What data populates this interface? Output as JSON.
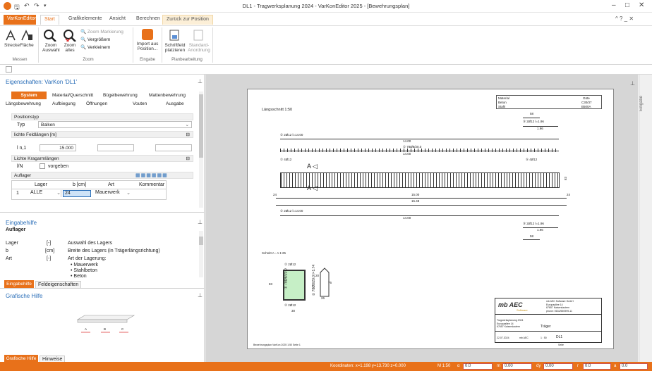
{
  "window": {
    "title": "DL1 - Tragwerksplanung 2024 - VarKonEditor 2025 - [Bewehrungsplan]",
    "controls": {
      "minimize": "–",
      "maximize": "□",
      "close": "✕"
    },
    "help": "^ ? _ ✕"
  },
  "tabs": [
    "VarKonEditor",
    "Start",
    "Grafikelemente",
    "Ansicht",
    "Berechnen",
    "Zurück zur Position"
  ],
  "ribbon": {
    "buttons": {
      "strecke": "Strecke",
      "flaeche": "Fläche",
      "zoom_auswahl": "Zoom\nAuswahl",
      "zoom_alles": "Zoom\nalles",
      "zoom_markierung": "Zoom Markierung",
      "vergroessern": "Vergrößern",
      "verkleinern": "Verkleinern",
      "import": "Import aus\nPosition...",
      "schriftfeld": "Schriftfeld\nplatzieren",
      "standard": "Standard-\nAnordnung"
    },
    "groups": {
      "messen": "Messen",
      "zoom": "Zoom",
      "eingabe": "Eingabe",
      "planbearbeitung": "Planbearbeitung"
    }
  },
  "properties": {
    "title": "Eigenschaften: VarKon 'DL1'",
    "tabs_row1": [
      "System",
      "Material/Querschnitt",
      "Bügelbewehrung",
      "Mattenbewehrung"
    ],
    "tabs_row2": [
      "Längsbewehrung",
      "Aufbiegung",
      "Öffnungen",
      "Vouten",
      "Ausgabe"
    ],
    "positionstyp": {
      "section": "Positionstyp",
      "label": "Typ",
      "value": "Balken"
    },
    "feldlaengen": {
      "section": "lichte Feldlängen [m]",
      "label": "l n,1",
      "value": "15.000"
    },
    "kragarm": {
      "section": "Lichte Kragarmlängen",
      "label": "l/N",
      "value": "vorgeben"
    },
    "auflager": {
      "section": "Auflager",
      "headers": [
        "Lager",
        "b [cm]",
        "Art",
        "Kommentar"
      ],
      "row": {
        "num": "1",
        "lager": "ALLE",
        "b": "24",
        "art": "Mauerwerk",
        "kommentar": ""
      }
    }
  },
  "eingabehilfe": {
    "title": "Eingabehilfe",
    "subtitle": "Auflager",
    "rows": [
      {
        "name": "Lager",
        "unit": "[-]",
        "desc": "Auswahl des Lagers"
      },
      {
        "name": "b",
        "unit": "[cm]",
        "desc": "Breite des Lagers (in Trägerlängsrichtung)"
      },
      {
        "name": "Art",
        "unit": "[-]",
        "desc": "Art der Lagerung:"
      }
    ],
    "bullets": [
      "• Mauerwerk",
      "• Stahlbeton",
      "• Beton"
    ],
    "tabs": [
      "Eingabehilfe",
      "Feldeigenschaften"
    ]
  },
  "grafische_hilfe": {
    "title": "Grafische Hilfe",
    "labels": [
      "A",
      "B",
      "C"
    ],
    "tabs": [
      "Grafische Hilfe",
      "Hinweise"
    ]
  },
  "drawing": {
    "laengsschnitt": "Längsschnitt 1:50",
    "material_table": [
      [
        "Material",
        "Güte"
      ],
      [
        "Beton",
        "C30/37"
      ],
      [
        "Stahl",
        "B500A"
      ]
    ],
    "bar2_top": "② 2Ø12 l=14.00",
    "bar2_under": "14.00",
    "bar1": "① 78Ø8/20.0",
    "bar1_under": "14.00",
    "left_bars": "② 4Ø12",
    "right_bars": "⑤ 4Ø12",
    "bar3_top": "③ 2Ø12 l=1.96",
    "bar3_top_dim": "58",
    "bar3_top_len": "1.96",
    "bar3_bottom": "③ 2Ø12 l=1.96",
    "bar3_bottom_dim": "58",
    "bar3_bottom_len": "1.96",
    "dim_24": "24",
    "dim_1500": "15.00",
    "dim_1548": "15.48",
    "bar2_bottom": "② 2Ø12 l=14.00",
    "bar2_bottom_under": "14.00",
    "height_dim": "83",
    "schnitt": "Schnitt A - A 1:25",
    "schnitt_top": "② 2Ø12",
    "schnitt_bottom": "② 2Ø12",
    "schnitt_width": "30",
    "schnitt_height": "83",
    "stirrup_label": "① 78Ø8/20.0",
    "stirrup_label2": "① 78Ø8/20.0 l=1.74",
    "stirrup_dims": [
      "20",
      "76",
      "26"
    ],
    "logo": "mb AEC",
    "logo_sub": "Software",
    "company": [
      "mb AEC Software GmbH",
      "Europaallee 14",
      "67657 Kaiserslautern",
      "phone: 0631/550999-11"
    ],
    "tb_projekt": [
      "Tragwerksplanung 2024",
      "Europaallee 14",
      "67657 Kaiserslautern"
    ],
    "tb_bauteil": "Träger",
    "tb_date": "22.07.2024",
    "tb_drawn": "mb AEC",
    "tb_scale": "1 : 50",
    "tb_plan": "DL1",
    "footer_left": "Bewehrungsplan VarKon 2025 1:50 Seite 1",
    "footer_right": "Seite"
  },
  "right_strip": "Eingabe",
  "status": {
    "coords": "Koordinaten: x=1.198 y=13.730 z=0.000",
    "scale": "M 1:50",
    "fields": [
      {
        "label": "α",
        "value": "0.0"
      },
      {
        "label": "m",
        "value": "0.00"
      },
      {
        "label": "dy",
        "value": "0.00"
      },
      {
        "label": "r",
        "value": "0.0"
      },
      {
        "label": "a",
        "value": "0.0"
      }
    ]
  },
  "colors": {
    "accent": "#e8711a",
    "title_blue": "#2a6eb8",
    "section_fill": "#c6efc6"
  }
}
